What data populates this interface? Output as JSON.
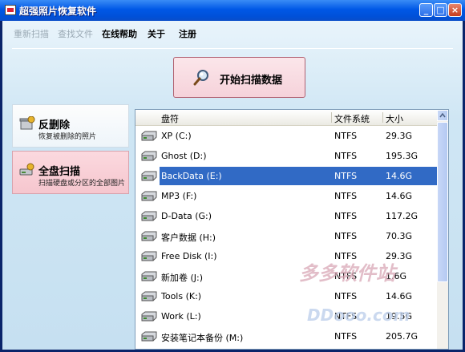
{
  "window": {
    "title": "超强照片恢复软件",
    "min_glyph": "_",
    "max_glyph": "□",
    "close_glyph": "×"
  },
  "menu": [
    {
      "label": "重新扫描",
      "enabled": false
    },
    {
      "label": "查找文件",
      "enabled": false
    },
    {
      "label": "在线帮助",
      "enabled": true
    },
    {
      "label": "关于",
      "enabled": true
    },
    {
      "label": "注册",
      "enabled": true
    }
  ],
  "scan_button": {
    "label": "开始扫描数据",
    "icon": "magnifier-icon"
  },
  "modes": [
    {
      "title": "反删除",
      "desc": "恢复被删除的照片",
      "icon": "recycle-icon",
      "selected": false
    },
    {
      "title": "全盘扫描",
      "desc": "扫描硬盘或分区的全部图片",
      "icon": "disk-scan-icon",
      "selected": true
    }
  ],
  "drive_list": {
    "columns": [
      "盘符",
      "文件系统",
      "大小"
    ],
    "rows": [
      {
        "name": "XP (C:)",
        "fs": "NTFS",
        "size": "29.3G"
      },
      {
        "name": "Ghost (D:)",
        "fs": "NTFS",
        "size": "195.3G"
      },
      {
        "name": "BackData (E:)",
        "fs": "NTFS",
        "size": "14.6G",
        "selected": true
      },
      {
        "name": "MP3 (F:)",
        "fs": "NTFS",
        "size": "14.6G"
      },
      {
        "name": "D-Data (G:)",
        "fs": "NTFS",
        "size": "117.2G"
      },
      {
        "name": "客户数据 (H:)",
        "fs": "NTFS",
        "size": "70.3G"
      },
      {
        "name": "Free Disk (I:)",
        "fs": "NTFS",
        "size": "29.3G"
      },
      {
        "name": "新加卷 (J:)",
        "fs": "NTFS",
        "size": "1.6G"
      },
      {
        "name": "Tools (K:)",
        "fs": "NTFS",
        "size": "14.6G"
      },
      {
        "name": "Work (L:)",
        "fs": "NTFS",
        "size": "19.5G"
      },
      {
        "name": "安装笔记本备份 (M:)",
        "fs": "NTFS",
        "size": "205.7G"
      }
    ]
  },
  "watermark": {
    "text1": "多多软件站",
    "text2": "DDooo.com"
  }
}
